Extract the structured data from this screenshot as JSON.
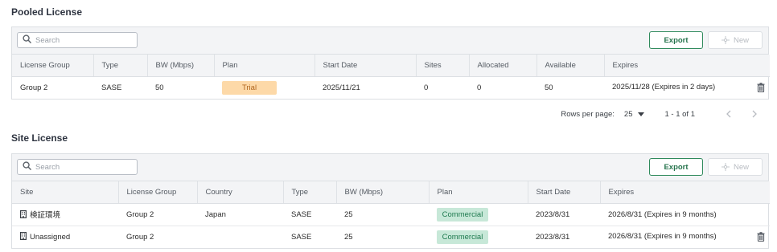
{
  "pooled": {
    "title": "Pooled License",
    "search_placeholder": "Search",
    "export_label": "Export",
    "new_label": "New",
    "columns": [
      "License Group",
      "Type",
      "BW (Mbps)",
      "Plan",
      "Start Date",
      "Sites",
      "Allocated",
      "Available",
      "Expires"
    ],
    "rows": [
      {
        "license_group": "Group 2",
        "type": "SASE",
        "bw": "50",
        "plan": "Trial",
        "start_date": "2025/11/21",
        "sites": "0",
        "allocated": "0",
        "available": "50",
        "expires": "2025/11/28 (Expires in 2 days)"
      }
    ]
  },
  "pagination": {
    "rows_per_page_label": "Rows per page:",
    "rows_per_page_value": "25",
    "range": "1 - 1 of 1"
  },
  "site": {
    "title": "Site License",
    "search_placeholder": "Search",
    "export_label": "Export",
    "new_label": "New",
    "columns": [
      "Site",
      "License Group",
      "Country",
      "Type",
      "BW (Mbps)",
      "Plan",
      "Start Date",
      "Expires"
    ],
    "rows": [
      {
        "site": "検証環境",
        "license_group": "Group 2",
        "country": "Japan",
        "type": "SASE",
        "bw": "25",
        "plan": "Commercial",
        "start_date": "2023/8/31",
        "expires": "2026/8/31 (Expires in 9 months)"
      },
      {
        "site": "Unassigned",
        "license_group": "Group 2",
        "country": "",
        "type": "SASE",
        "bw": "25",
        "plan": "Commercial",
        "start_date": "2023/8/31",
        "expires": "2026/8/31 (Expires in 9 months)"
      }
    ]
  },
  "colors": {
    "accent_green": "#25734c",
    "trial_badge": "#fdd9a8",
    "commercial_badge": "#c7e8d8",
    "header_bg": "#f3f4f6"
  },
  "icons": [
    "search-icon",
    "plus-icon",
    "trash-icon",
    "building-icon",
    "chevron-down-icon",
    "chevron-left-icon",
    "chevron-right-icon"
  ]
}
